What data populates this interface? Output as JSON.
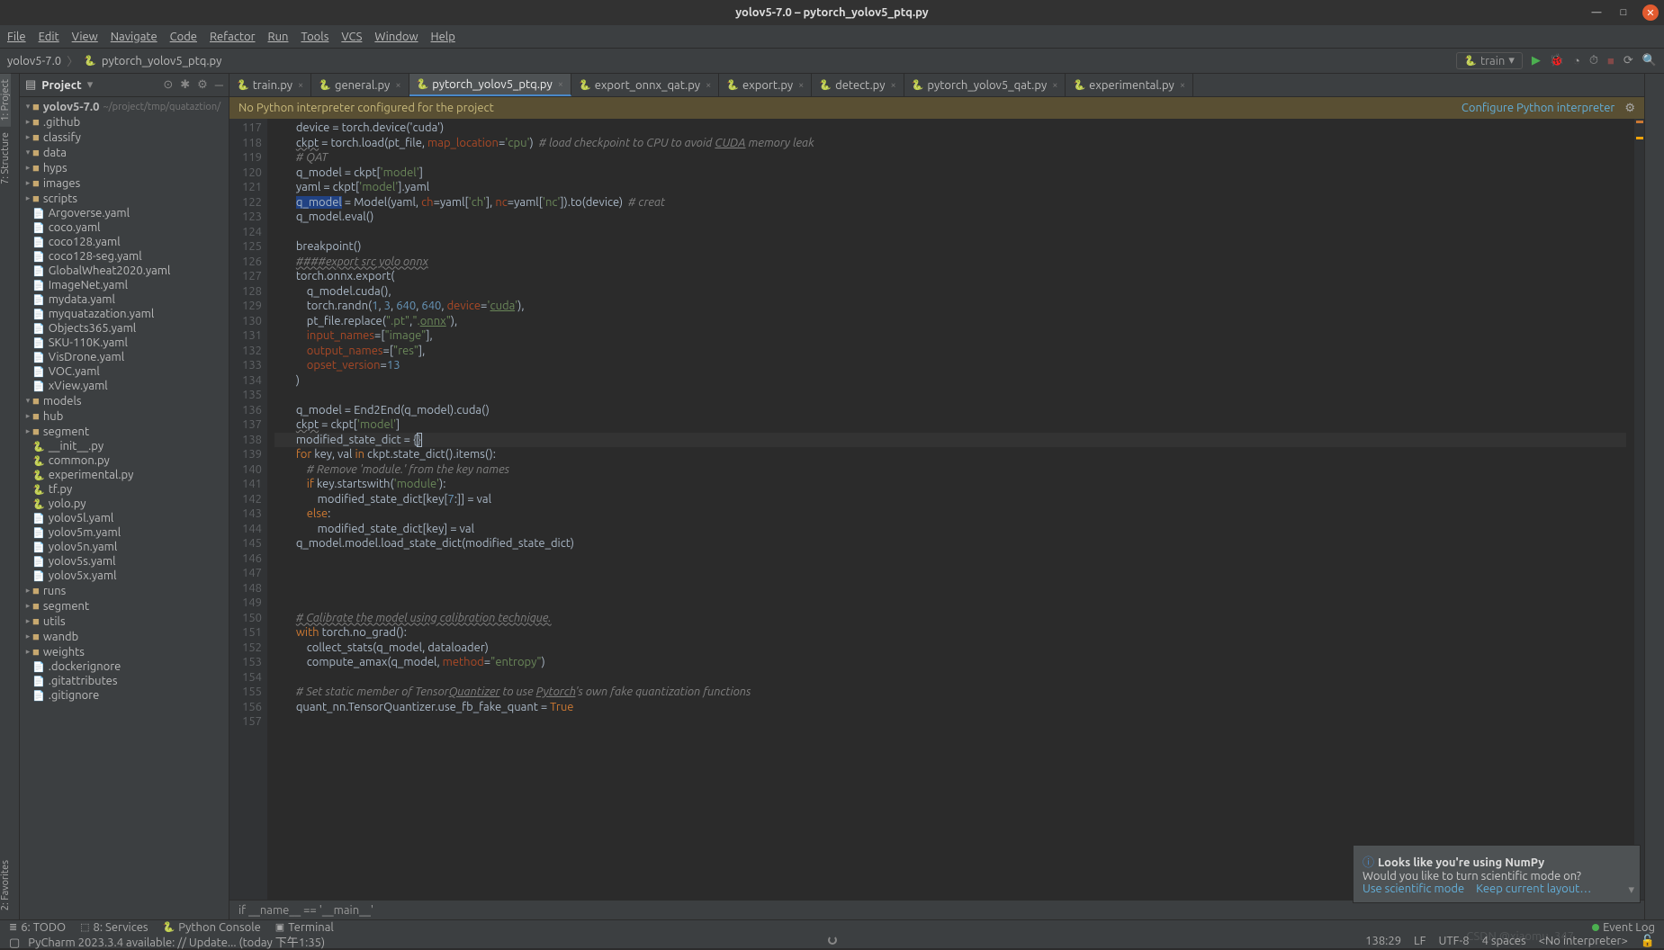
{
  "window": {
    "title": "yolov5-7.0 – pytorch_yolov5_ptq.py"
  },
  "menu": {
    "file": "File",
    "edit": "Edit",
    "view": "View",
    "navigate": "Navigate",
    "code": "Code",
    "refactor": "Refactor",
    "run": "Run",
    "tools": "Tools",
    "vcs": "VCS",
    "window": "Window",
    "help": "Help"
  },
  "breadcrumbs": {
    "root": "yolov5-7.0",
    "file": "pytorch_yolov5_ptq.py"
  },
  "runconfig": {
    "name": "train"
  },
  "tool_windows": {
    "project": "1: Project",
    "structure": "7: Structure",
    "favorites": "2: Favorites",
    "todo": "6: TODO",
    "services": "8: Services",
    "python_console": "Python Console",
    "terminal": "Terminal",
    "event_log": "Event Log"
  },
  "project_panel": {
    "title": "Project"
  },
  "tree": {
    "root": {
      "name": "yolov5-7.0",
      "path": "~/project/tmp/quataztion/"
    },
    "items": [
      {
        "depth": 1,
        "open": false,
        "type": "dir",
        "name": ".github"
      },
      {
        "depth": 1,
        "open": false,
        "type": "dir",
        "name": "classify"
      },
      {
        "depth": 1,
        "open": true,
        "type": "dir",
        "name": "data"
      },
      {
        "depth": 2,
        "open": false,
        "type": "dir",
        "name": "hyps"
      },
      {
        "depth": 2,
        "open": false,
        "type": "dir",
        "name": "images"
      },
      {
        "depth": 2,
        "open": false,
        "type": "dir",
        "name": "scripts"
      },
      {
        "depth": 2,
        "type": "file",
        "name": "Argoverse.yaml"
      },
      {
        "depth": 2,
        "type": "file",
        "name": "coco.yaml"
      },
      {
        "depth": 2,
        "type": "file",
        "name": "coco128.yaml"
      },
      {
        "depth": 2,
        "type": "file",
        "name": "coco128-seg.yaml"
      },
      {
        "depth": 2,
        "type": "file",
        "name": "GlobalWheat2020.yaml"
      },
      {
        "depth": 2,
        "type": "file",
        "name": "ImageNet.yaml"
      },
      {
        "depth": 2,
        "type": "file",
        "name": "mydata.yaml"
      },
      {
        "depth": 2,
        "type": "file",
        "name": "myquatazation.yaml"
      },
      {
        "depth": 2,
        "type": "file",
        "name": "Objects365.yaml"
      },
      {
        "depth": 2,
        "type": "file",
        "name": "SKU-110K.yaml"
      },
      {
        "depth": 2,
        "type": "file",
        "name": "VisDrone.yaml"
      },
      {
        "depth": 2,
        "type": "file",
        "name": "VOC.yaml"
      },
      {
        "depth": 2,
        "type": "file",
        "name": "xView.yaml"
      },
      {
        "depth": 1,
        "open": true,
        "type": "dir",
        "name": "models"
      },
      {
        "depth": 2,
        "open": false,
        "type": "dir",
        "name": "hub"
      },
      {
        "depth": 2,
        "open": false,
        "type": "dir",
        "name": "segment"
      },
      {
        "depth": 2,
        "type": "py",
        "name": "__init__.py"
      },
      {
        "depth": 2,
        "type": "py",
        "name": "common.py"
      },
      {
        "depth": 2,
        "type": "py",
        "name": "experimental.py"
      },
      {
        "depth": 2,
        "type": "py",
        "name": "tf.py"
      },
      {
        "depth": 2,
        "type": "py",
        "name": "yolo.py"
      },
      {
        "depth": 2,
        "type": "file",
        "name": "yolov5l.yaml"
      },
      {
        "depth": 2,
        "type": "file",
        "name": "yolov5m.yaml"
      },
      {
        "depth": 2,
        "type": "file",
        "name": "yolov5n.yaml"
      },
      {
        "depth": 2,
        "type": "file",
        "name": "yolov5s.yaml"
      },
      {
        "depth": 2,
        "type": "file",
        "name": "yolov5x.yaml"
      },
      {
        "depth": 1,
        "open": false,
        "type": "dir",
        "name": "runs"
      },
      {
        "depth": 1,
        "open": false,
        "type": "dir",
        "name": "segment"
      },
      {
        "depth": 1,
        "open": false,
        "type": "dir",
        "name": "utils"
      },
      {
        "depth": 1,
        "open": false,
        "type": "dir",
        "name": "wandb"
      },
      {
        "depth": 1,
        "open": false,
        "type": "dir",
        "name": "weights"
      },
      {
        "depth": 1,
        "type": "file",
        "name": ".dockerignore"
      },
      {
        "depth": 1,
        "type": "file",
        "name": ".gitattributes"
      },
      {
        "depth": 1,
        "type": "file",
        "name": ".gitignore"
      }
    ]
  },
  "tabs": [
    {
      "name": "train.py",
      "active": false
    },
    {
      "name": "general.py",
      "active": false
    },
    {
      "name": "pytorch_yolov5_ptq.py",
      "active": true
    },
    {
      "name": "export_onnx_qat.py",
      "active": false
    },
    {
      "name": "export.py",
      "active": false
    },
    {
      "name": "detect.py",
      "active": false
    },
    {
      "name": "pytorch_yolov5_qat.py",
      "active": false
    },
    {
      "name": "experimental.py",
      "active": false
    }
  ],
  "banner": {
    "msg": "No Python interpreter configured for the project",
    "action": "Configure Python interpreter"
  },
  "gutter": {
    "start": 117,
    "end": 157
  },
  "code": {
    "lines": [
      "        device = torch.device('cuda')",
      "        <span class='un'>ckpt</span> = torch.load(pt_file, <span class='pn'>map_location</span>=<span class='str'>'cpu'</span>)  <span class='cm'># load checkpoint to CPU to avoid <u>CUDA</u> memory leak</span>",
      "        <span class='cm'># QAT</span>",
      "        q_model = ckpt[<span class='str'>'model'</span>]",
      "        yaml = ckpt[<span class='str'>'model'</span>].yaml",
      "        <span style='background:#214283'>q_model</span> = Model(yaml, <span class='pn'>ch</span>=yaml[<span class='str'>'ch'</span>], <span class='pn'>nc</span>=yaml[<span class='str'>'nc'</span>]).to(device)  <span class='cm'># creat</span>",
      "        q_model.eval()",
      "",
      "        breakpoint()",
      "        <span class='cm un'>####export src yolo onnx</span>",
      "        torch.onnx.export(",
      "            q_model.cuda(),",
      "            torch.randn(<span class='num'>1</span>, <span class='num'>3</span>, <span class='num'>640</span>, <span class='num'>640</span>, <span class='pn'>device</span>=<span class='str'>'<u>cuda</u>'</span>),",
      "            pt_file.replace(<span class='str'>\".pt\"</span>,<span class='str'>\".<u>onnx</u>\"</span>),",
      "            <span class='pn'>input_names</span>=[<span class='str'>\"image\"</span>],",
      "            <span class='pn'>output_names</span>=[<span class='str'>\"res\"</span>],",
      "            <span class='pn'>opset_version</span>=<span class='num'>13</span>",
      "        )",
      "",
      "        q_model = End2End(q_model).cuda()",
      "        <span class='un'>ckpt</span> = ckpt[<span class='str'>'model'</span>]",
      "<span class='curhl'>        modified_state_dict = {<span style='outline:1px solid #a9b7c6'>}</span></span>",
      "        <span class='kw'>for</span> key, val <span class='kw'>in</span> ckpt.state_dict().items():",
      "            <span class='cm'># Remove 'module.' from the key names</span>",
      "            <span class='kw'>if</span> key.startswith(<span class='str'>'module'</span>):",
      "                modified_state_dict[key[<span class='num'>7</span>:]] = val",
      "            <span class='kw'>else</span>:",
      "                modified_state_dict[key] = val",
      "        q_model.model.load_state_dict(modified_state_dict)",
      "",
      "",
      "",
      "",
      "        <span class='cm un'># Calibrate the model using calibration technique.</span>",
      "        <span class='kw'>with</span> torch.no_grad():",
      "            collect_stats(q_model, dataloader)",
      "            compute_amax(q_model, <span class='pn'>method</span>=<span class='str'>\"entropy\"</span>)",
      "",
      "        <span class='cm'># Set static member of Tensor<u>Quantizer</u> to use <u>Pytorch</u>'s own fake quantization functions</span>",
      "        quant_nn.TensorQuantizer.use_fb_fake_quant = <span class='kw'>True</span>",
      ""
    ]
  },
  "context": "if __name__ == '__main__'",
  "notification": {
    "title": "Looks like you're using NumPy",
    "body": "Would you like to turn scientific mode on?",
    "link1": "Use scientific mode",
    "link2": "Keep current layout…"
  },
  "status": {
    "left_msg": "PyCharm 2023.3.4 available: // Update... (today 下午1:35)",
    "pos": "138:29",
    "lf": "LF",
    "enc": "UTF-8",
    "indent": "4 spaces",
    "interp": "<No interpreter>"
  },
  "watermark": "CSDN @xiaomu_347"
}
